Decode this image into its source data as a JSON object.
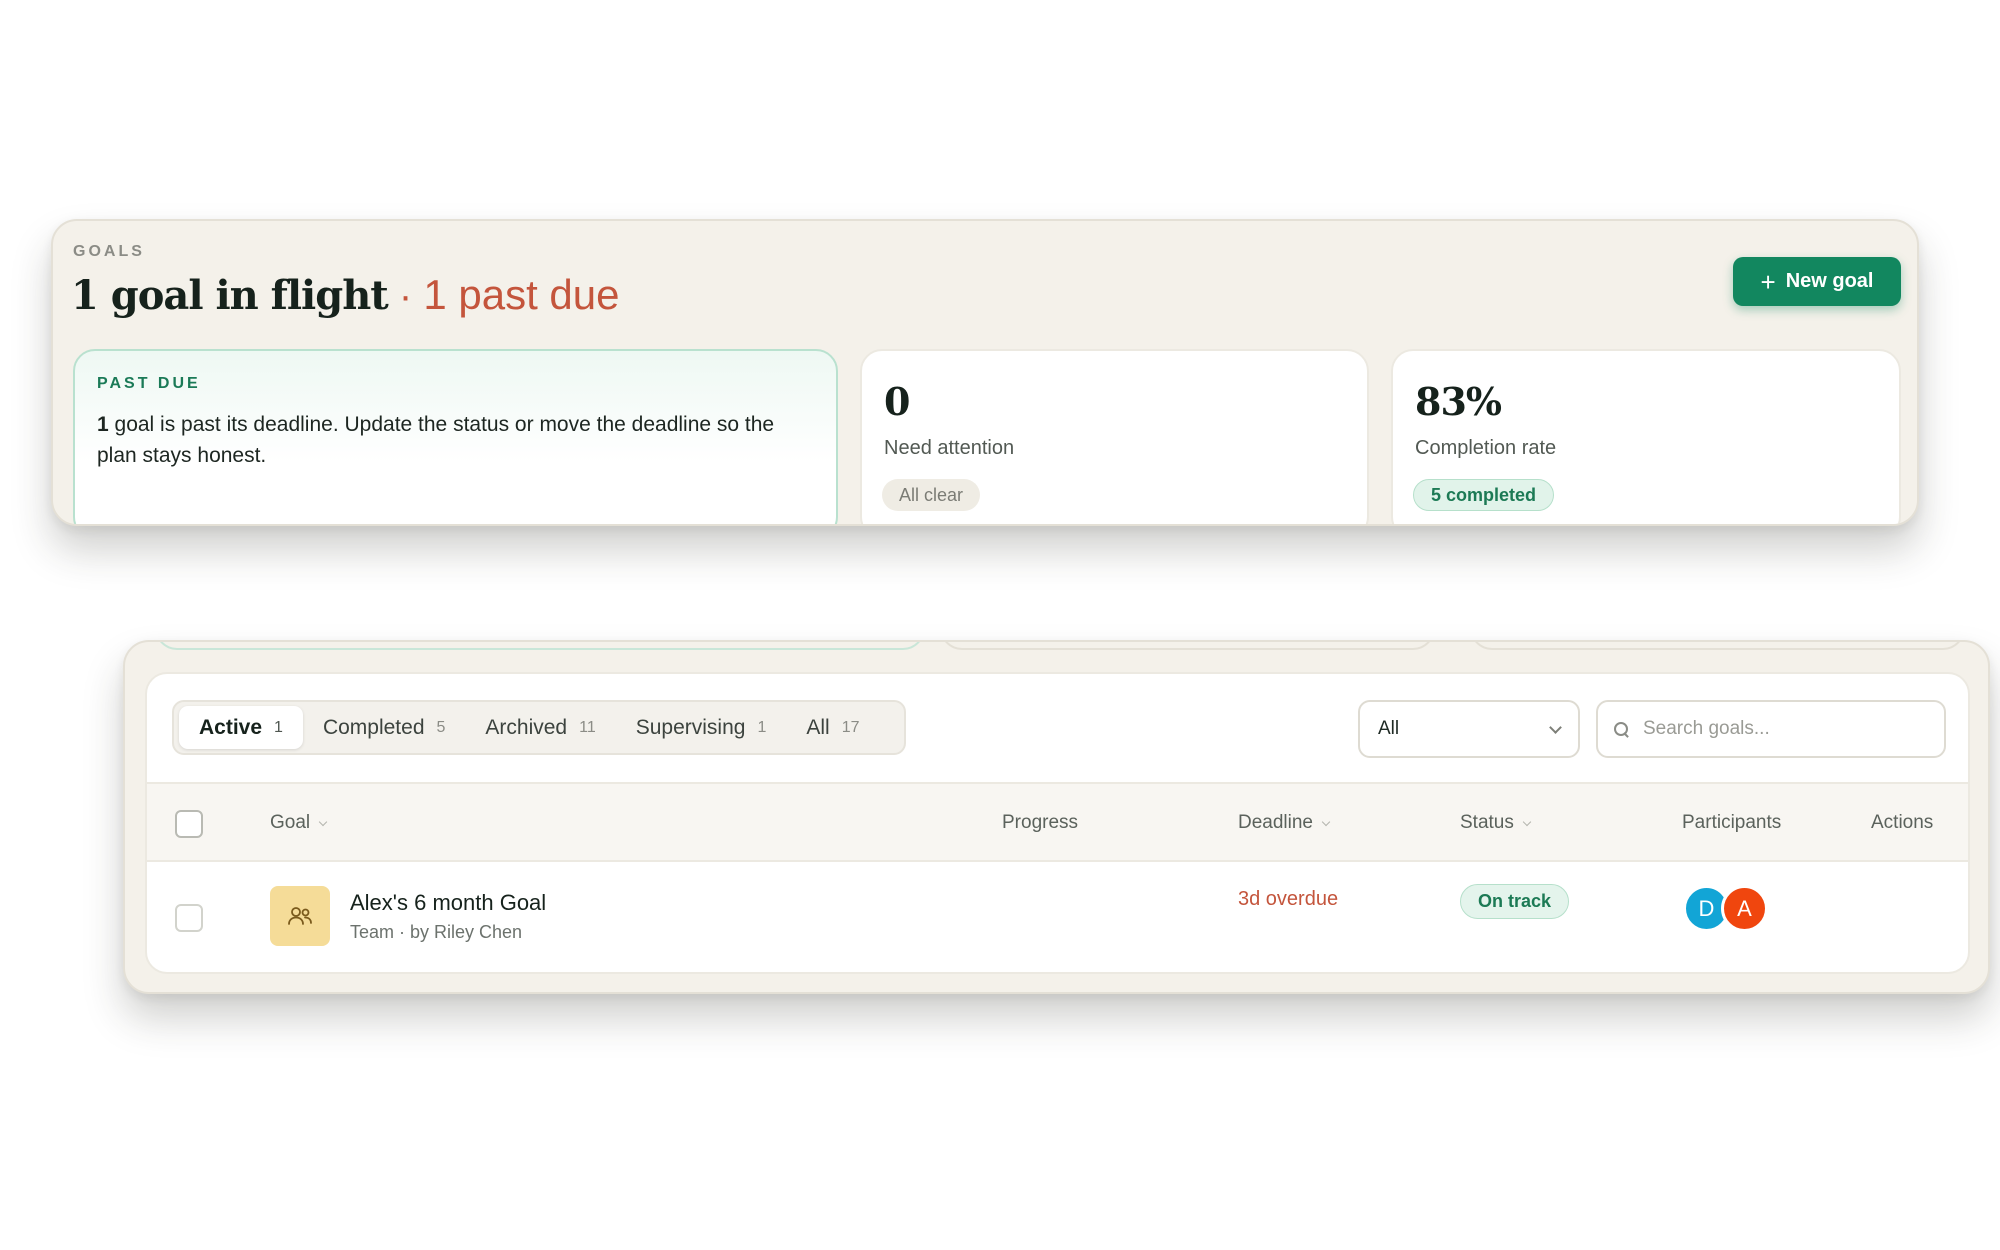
{
  "summary": {
    "eyebrow": "GOALS",
    "headline_main": "1 goal in flight",
    "headline_sep": " · ",
    "headline_due": "1 past due",
    "new_goal_label": "New goal",
    "alert_card": {
      "eyebrow": "PAST DUE",
      "count": "1",
      "text": " goal is past its deadline. Update the status or move the deadline so the plan stays honest."
    },
    "attention_card": {
      "value": "0",
      "label": "Need attention",
      "chip": "All clear"
    },
    "completion_card": {
      "value": "83%",
      "label": "Completion rate",
      "chip": "5 completed"
    }
  },
  "tabs": [
    {
      "label": "Active",
      "count": "1",
      "active": true
    },
    {
      "label": "Completed",
      "count": "5"
    },
    {
      "label": "Archived",
      "count": "11"
    },
    {
      "label": "Supervising",
      "count": "1"
    },
    {
      "label": "All",
      "count": "17"
    }
  ],
  "filter": {
    "selected": "All"
  },
  "search": {
    "placeholder": "Search goals..."
  },
  "table": {
    "columns": {
      "goal": "Goal",
      "progress": "Progress",
      "deadline": "Deadline",
      "status": "Status",
      "participants": "Participants",
      "actions": "Actions"
    },
    "rows": [
      {
        "title": "Alex's 6 month Goal",
        "subtitle": "Team · by Riley Chen",
        "icon": "team-icon",
        "deadline": "3d overdue",
        "status": "On track",
        "participants": [
          "D",
          "A"
        ]
      }
    ]
  },
  "colors": {
    "accent": "#12875f",
    "overdue": "#c4553c",
    "avatar_d": "#12a5d6",
    "avatar_a": "#f0460e",
    "goal_icon_bg": "#f5dc98"
  }
}
